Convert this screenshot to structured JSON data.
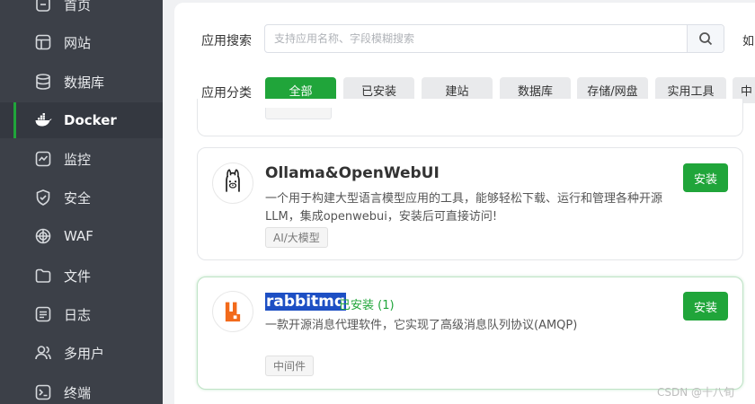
{
  "sidebar": {
    "items": [
      {
        "label": "首页",
        "icon": "home-icon",
        "active": false
      },
      {
        "label": "网站",
        "icon": "website-icon",
        "active": false
      },
      {
        "label": "数据库",
        "icon": "database-icon",
        "active": false
      },
      {
        "label": "Docker",
        "icon": "docker-icon",
        "active": true
      },
      {
        "label": "监控",
        "icon": "monitor-icon",
        "active": false
      },
      {
        "label": "安全",
        "icon": "shield-icon",
        "active": false
      },
      {
        "label": "WAF",
        "icon": "waf-icon",
        "active": false
      },
      {
        "label": "文件",
        "icon": "folder-icon",
        "active": false
      },
      {
        "label": "日志",
        "icon": "log-icon",
        "active": false
      },
      {
        "label": "多用户",
        "icon": "users-icon",
        "active": false
      },
      {
        "label": "终端",
        "icon": "terminal-icon",
        "active": false
      }
    ]
  },
  "search": {
    "label": "应用搜索",
    "placeholder": "支持应用名称、字段模糊搜索",
    "value": "",
    "trailing_text": "如"
  },
  "categories": {
    "label": "应用分类",
    "items": [
      "全部",
      "已安装",
      "建站",
      "数据库",
      "存储/网盘",
      "实用工具",
      "中"
    ],
    "active_index": 0
  },
  "apps": [
    {
      "name": "Ollama&OpenWebUI",
      "installed_text": "",
      "description": "一个用于构建大型语言模型应用的工具，能够轻松下载、运行和管理各种开源 LLM，集成openwebui，安装后可直接访问!",
      "tag": "AI/大模型",
      "button": "安装",
      "logo_icon": "ollama-logo-icon"
    },
    {
      "name": "rabbitmq",
      "installed_text": "已安装 (1)",
      "description": "一款开源消息代理软件，它实现了高级消息队列协议(AMQP)",
      "tag": "中间件",
      "button": "安装",
      "logo_icon": "rabbitmq-logo-icon"
    }
  ],
  "watermark": "CSDN @十八旬",
  "colors": {
    "accent": "#20a53a",
    "sidebar_bg": "#3c4048",
    "highlight": "#1d4fc4"
  }
}
